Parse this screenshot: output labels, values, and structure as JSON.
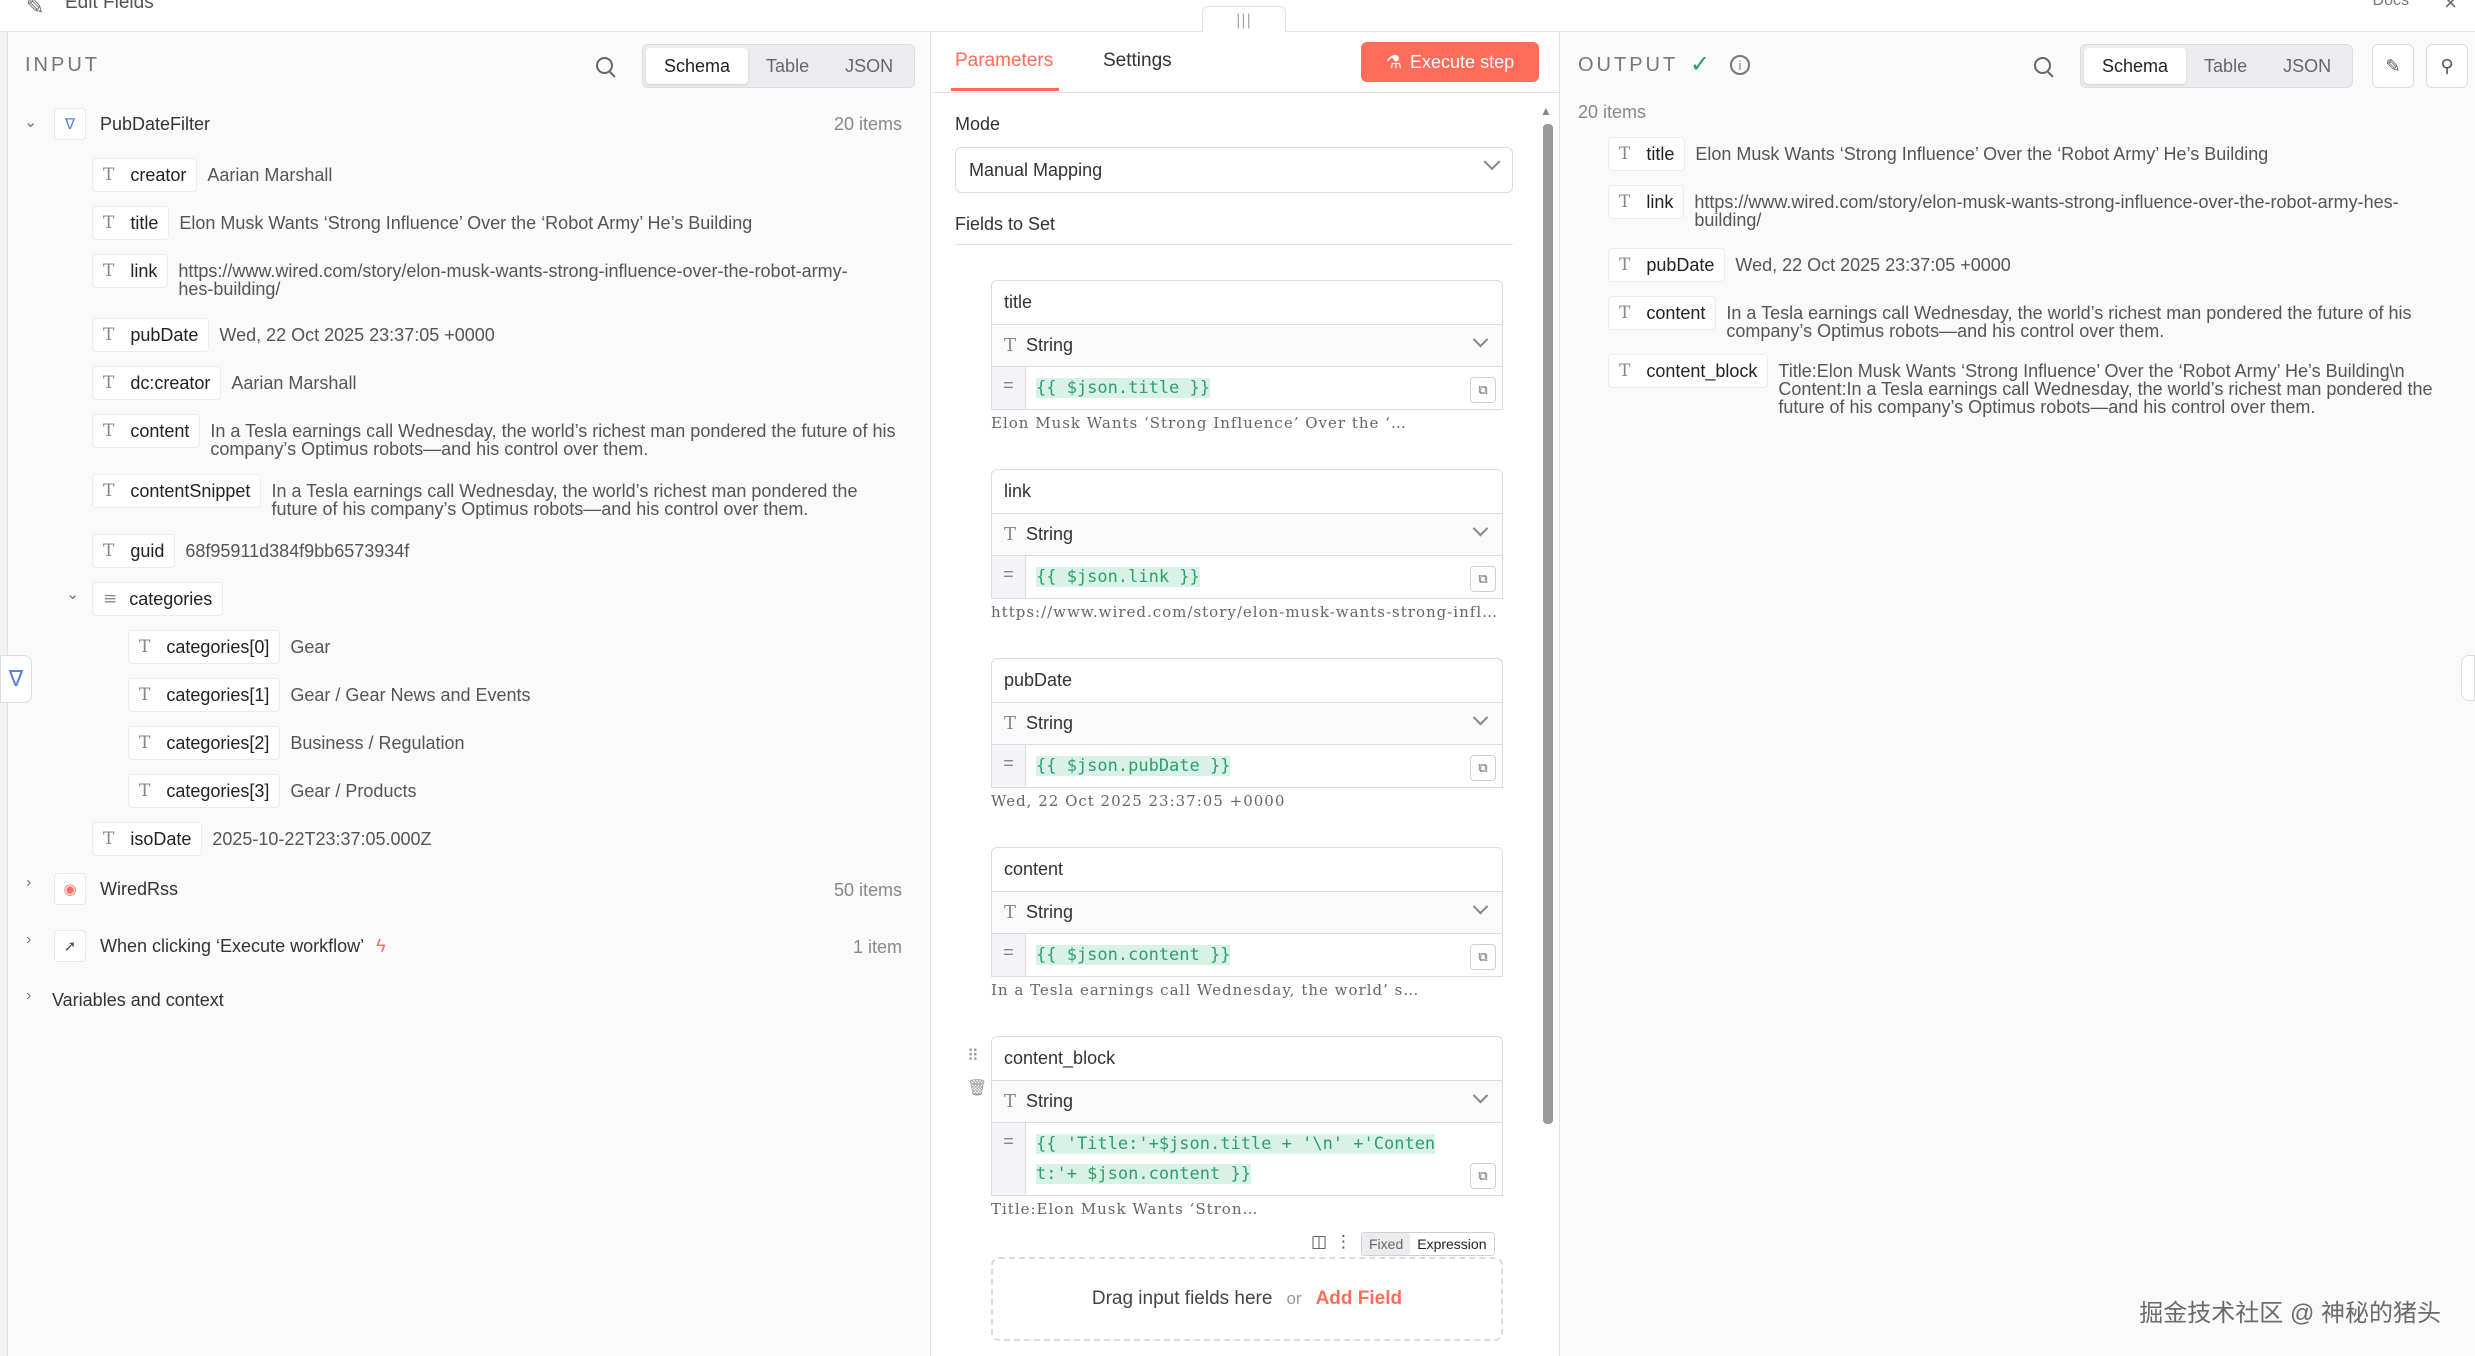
{
  "topbar": {
    "title": "Edit Fields",
    "docs": "Docs"
  },
  "input": {
    "label": "INPUT",
    "views": [
      "Schema",
      "Table",
      "JSON"
    ],
    "active_view": "Schema",
    "node": {
      "name": "PubDateFilter",
      "count": "20 items"
    },
    "fields": [
      {
        "key": "creator",
        "value": "Aarian Marshall"
      },
      {
        "key": "title",
        "value": "Elon Musk Wants ‘Strong Influence’ Over the ‘Robot Army’ He’s Building"
      },
      {
        "key": "link",
        "value": "https://www.wired.com/story/elon-musk-wants-strong-influence-over-the-robot-army-hes-building/"
      },
      {
        "key": "pubDate",
        "value": "Wed, 22 Oct 2025 23:37:05 +0000"
      },
      {
        "key": "dc:creator",
        "value": "Aarian Marshall"
      },
      {
        "key": "content",
        "value": "In a Tesla earnings call Wednesday, the world’s richest man pondered the future of his company’s Optimus robots—and his control over them."
      },
      {
        "key": "contentSnippet",
        "value": "In a Tesla earnings call Wednesday, the world’s richest man pondered the future of his company’s Optimus robots—and his control over them."
      },
      {
        "key": "guid",
        "value": "68f95911d384f9bb6573934f"
      }
    ],
    "categories": {
      "key": "categories",
      "items": [
        {
          "key": "categories[0]",
          "value": "Gear"
        },
        {
          "key": "categories[1]",
          "value": "Gear / Gear News and Events"
        },
        {
          "key": "categories[2]",
          "value": "Business / Regulation"
        },
        {
          "key": "categories[3]",
          "value": "Gear / Products"
        }
      ]
    },
    "isoDate": {
      "key": "isoDate",
      "value": "2025-10-22T23:37:05.000Z"
    },
    "other_nodes": [
      {
        "name": "WiredRss",
        "count": "50 items"
      },
      {
        "name": "When clicking ‘Execute workflow’",
        "count": "1 item"
      }
    ],
    "variables": "Variables and context"
  },
  "params": {
    "tabs": [
      "Parameters",
      "Settings"
    ],
    "execute": "Execute step",
    "mode_label": "Mode",
    "mode_value": "Manual Mapping",
    "fields_label": "Fields to Set",
    "fields": [
      {
        "name": "title",
        "type": "String",
        "expr": [
          "{{ $json.title }}"
        ],
        "preview": "Elon  Musk  Wants  ‘Strong  Influence’  Over  the  ‘…"
      },
      {
        "name": "link",
        "type": "String",
        "expr": [
          "{{ $json.link }}"
        ],
        "preview": "https://www.wired.com/story/elon-musk-wants-strong-infl…"
      },
      {
        "name": "pubDate",
        "type": "String",
        "expr": [
          "{{ $json.pubDate }}"
        ],
        "preview": "Wed,  22  Oct  2025  23:37:05  +0000"
      },
      {
        "name": "content",
        "type": "String",
        "expr": [
          "{{ $json.content }}"
        ],
        "preview": "In  a  Tesla  earnings  call  Wednesday,  the  world’ s…"
      },
      {
        "name": "content_block",
        "type": "String",
        "expr": [
          "{{ 'Title:'+$json.title + '\\n' +'Conten",
          "t:'+ $json.content }}"
        ],
        "preview": "Title:Elon  Musk  Wants  ‘Stron…"
      }
    ],
    "toggle": {
      "fixed": "Fixed",
      "expression": "Expression"
    },
    "dropzone": {
      "text": "Drag input fields here",
      "or": "or",
      "add": "Add Field"
    }
  },
  "output": {
    "label": "OUTPUT",
    "views": [
      "Schema",
      "Table",
      "JSON"
    ],
    "active_view": "Schema",
    "count": "20 items",
    "fields": [
      {
        "key": "title",
        "value": "Elon Musk Wants ‘Strong Influence’ Over the ‘Robot Army’ He’s Building"
      },
      {
        "key": "link",
        "value": "https://www.wired.com/story/elon-musk-wants-strong-influence-over-the-robot-army-hes-building/"
      },
      {
        "key": "pubDate",
        "value": "Wed, 22 Oct 2025 23:37:05 +0000"
      },
      {
        "key": "content",
        "value": "In a Tesla earnings call Wednesday, the world’s richest man pondered the future of his company’s Optimus robots—and his control over them."
      },
      {
        "key": "content_block",
        "value": "Title:Elon Musk Wants ‘Strong Influence’ Over the ‘Robot Army’ He’s Building\\n Content:In a Tesla earnings call Wednesday, the world’s richest man pondered the future of his company’s Optimus robots—and his control over them."
      }
    ]
  },
  "watermark": "掘金技术社区 @ 神秘的猪头",
  "colors": {
    "accent": "#ff6d5a",
    "success": "#2f9e6e",
    "filter": "#5b7de0"
  }
}
